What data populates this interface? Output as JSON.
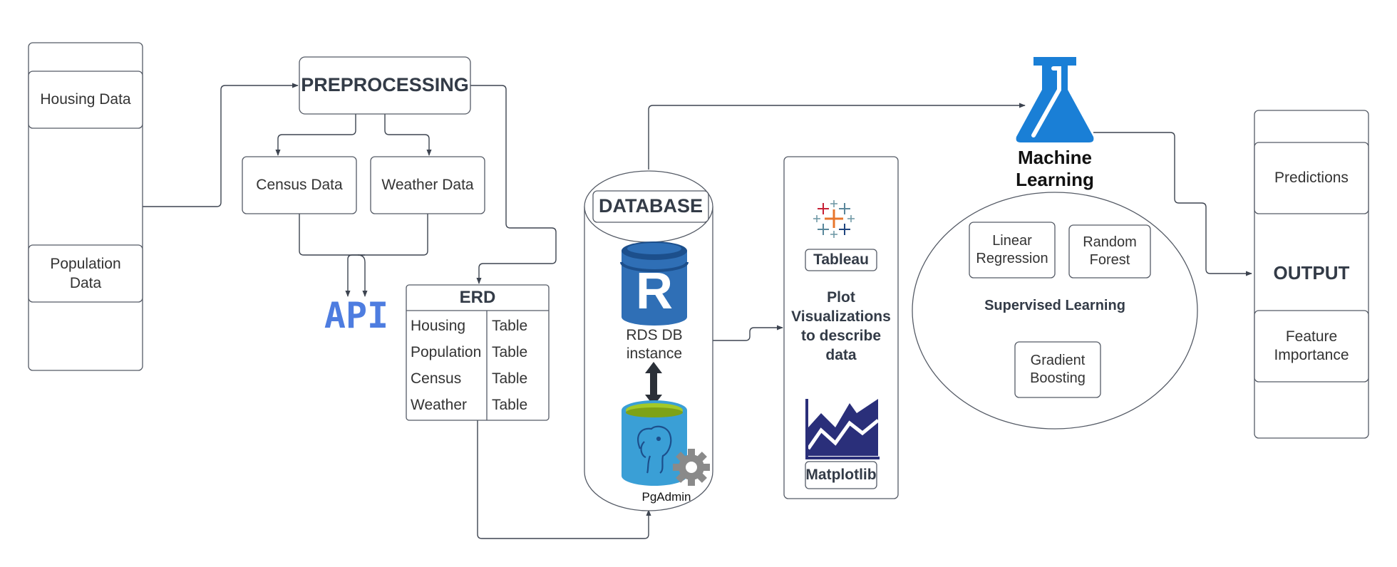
{
  "inputs": {
    "housing": "Housing Data",
    "population": [
      "Population",
      "Data"
    ]
  },
  "preprocessing": {
    "title": "PREPROCESSING",
    "census": "Census Data",
    "weather": "Weather Data",
    "api": "API"
  },
  "erd": {
    "title": "ERD",
    "rows": [
      {
        "name": "Housing",
        "type": "Table"
      },
      {
        "name": "Population",
        "type": "Table"
      },
      {
        "name": "Census",
        "type": "Table"
      },
      {
        "name": "Weather",
        "type": "Table"
      }
    ]
  },
  "database": {
    "title": "DATABASE",
    "rds_letter": "R",
    "rds": [
      "RDS DB",
      "instance"
    ],
    "pgadmin": "PgAdmin"
  },
  "visualization": {
    "tableau": "Tableau",
    "plot": [
      "Plot",
      "Visualizations",
      "to describe",
      "data"
    ],
    "matplotlib": "Matplotlib"
  },
  "ml": {
    "title": [
      "Machine",
      "Learning"
    ],
    "linear": [
      "Linear",
      "Regression"
    ],
    "random": [
      "Random",
      "Forest"
    ],
    "supervised": "Supervised Learning",
    "gradient": [
      "Gradient",
      "Boosting"
    ]
  },
  "output": {
    "predictions": "Predictions",
    "title": "OUTPUT",
    "feature": [
      "Feature",
      "Importance"
    ]
  },
  "colors": {
    "line": "#3d4450",
    "box_border": "#555b66",
    "rds_blue": "#2f6fb6",
    "rds_dark": "#1c4f8c",
    "flask_blue": "#1a7fd6",
    "api_blue": "#4e7de0",
    "matplotlib_navy": "#2a2f7a",
    "pg_blue": "#3a9fd6",
    "pg_green": "#a3c928"
  },
  "icons": [
    "flask-icon",
    "tableau-icon",
    "area-chart-icon",
    "database-icon",
    "elephant-icon",
    "gear-icon",
    "double-arrow-icon"
  ]
}
